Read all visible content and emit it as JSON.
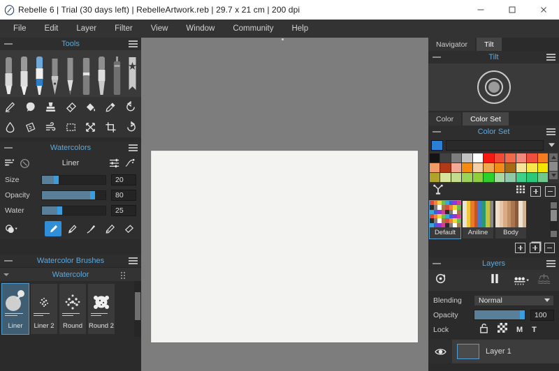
{
  "window": {
    "title": "Rebelle 6 | Trial (30 days left) | RebelleArtwork.reb | 29.7 x 21 cm | 200 dpi",
    "app_icon": "rebelle-logo-icon",
    "minimize_label": "–",
    "maximize_label": "□",
    "close_label": "✕"
  },
  "menubar": {
    "items": [
      {
        "label": "File"
      },
      {
        "label": "Edit"
      },
      {
        "label": "Layer"
      },
      {
        "label": "Filter"
      },
      {
        "label": "View"
      },
      {
        "label": "Window"
      },
      {
        "label": "Community"
      },
      {
        "label": "Help"
      }
    ]
  },
  "tools_panel": {
    "title": "Tools",
    "brushes": [
      {
        "name": "marker-tool",
        "selected": false
      },
      {
        "name": "ink-pen-tool",
        "selected": false
      },
      {
        "name": "watercolor-brush-tool",
        "selected": true
      },
      {
        "name": "nib-pen-tool",
        "selected": false
      },
      {
        "name": "pencil-tool",
        "selected": false
      },
      {
        "name": "pastel-tool",
        "selected": false
      },
      {
        "name": "oil-brush-tool",
        "selected": false
      },
      {
        "name": "airbrush-tool",
        "selected": false
      },
      {
        "name": "favorites-tool",
        "selected": false
      }
    ],
    "icons_row_1": [
      {
        "name": "blend-icon",
        "label": "Blend"
      },
      {
        "name": "smudge-icon",
        "label": "Smudge"
      },
      {
        "name": "stamp-icon",
        "label": "Stamp"
      },
      {
        "name": "eraser-icon",
        "label": "Eraser"
      },
      {
        "name": "fill-icon",
        "label": "Fill"
      },
      {
        "name": "eyedropper-icon",
        "label": "Pick Color"
      },
      {
        "name": "undo-icon",
        "label": "Undo"
      }
    ],
    "icons_row_2": [
      {
        "name": "water-drop-icon",
        "label": "Water"
      },
      {
        "name": "dry-icon",
        "label": "Dry"
      },
      {
        "name": "blow-icon",
        "label": "Blow"
      },
      {
        "name": "selection-icon",
        "label": "Select"
      },
      {
        "name": "transform-icon",
        "label": "Transform"
      },
      {
        "name": "crop-icon",
        "label": "Crop"
      },
      {
        "name": "rotate-icon",
        "label": "Rotate"
      }
    ]
  },
  "watercolors_panel": {
    "title": "Watercolors",
    "brush_name": "Liner",
    "left_icons": [
      {
        "name": "brush-presets-icon"
      },
      {
        "name": "reset-brush-icon"
      }
    ],
    "right_icons": [
      {
        "name": "brush-settings-icon"
      },
      {
        "name": "brush-dynamics-icon"
      }
    ],
    "sliders": [
      {
        "label": "Size",
        "value": "20",
        "percent": 22
      },
      {
        "label": "Opacity",
        "value": "80",
        "percent": 80
      },
      {
        "label": "Water",
        "value": "25",
        "percent": 28
      }
    ],
    "mode_menu_icon": "blend-mode-icon",
    "mode_buttons": [
      {
        "name": "paint-mode-button",
        "active": true
      },
      {
        "name": "wet-brush-mode-button",
        "active": false
      },
      {
        "name": "dry-brush-mode-button",
        "active": false
      },
      {
        "name": "pen-mode-button",
        "active": false
      },
      {
        "name": "eraser-mode-button",
        "active": false
      }
    ]
  },
  "brushes_panel": {
    "title": "Watercolor Brushes",
    "category": "Watercolor",
    "items": [
      {
        "label": "Liner",
        "selected": true
      },
      {
        "label": "Liner 2",
        "selected": false
      },
      {
        "label": "Round",
        "selected": false
      },
      {
        "label": "Round 2",
        "selected": false
      }
    ]
  },
  "navigator_panel": {
    "tabs": [
      {
        "label": "Navigator",
        "active": false
      },
      {
        "label": "Tilt",
        "active": true
      }
    ],
    "tilt_title": "Tilt",
    "tilt_control_icon": "tilt-joystick-icon"
  },
  "color_panel": {
    "tabs": [
      {
        "label": "Color",
        "active": false
      },
      {
        "label": "Color Set",
        "active": true
      }
    ],
    "title": "Color Set",
    "current_color": "#2b7fd4",
    "search_placeholder": "",
    "swatches": [
      "#141414",
      "#414141",
      "#7d7d7d",
      "#c2c2c2",
      "#ffffff",
      "#f51b12",
      "#f04b34",
      "#f06a4a",
      "#f0887c",
      "#ef4f3e",
      "#f57c20",
      "#f09a68",
      "#b03a18",
      "#f3a993",
      "#f58b10",
      "#f6cfa4",
      "#f0a84e",
      "#f08c18",
      "#a96a14",
      "#f5e49a",
      "#f5e64a",
      "#f5e400",
      "#b0a22a",
      "#d8e29a",
      "#c3dd8e",
      "#9cd45a",
      "#8fcf3c",
      "#2fd02c",
      "#a8d8a2",
      "#8fc9a8",
      "#3fd08a",
      "#2bc97a",
      "#6fc98a"
    ],
    "tools": [
      {
        "name": "color-mixer-icon"
      },
      {
        "name": "grid-view-icon"
      },
      {
        "name": "add-color-button"
      },
      {
        "name": "remove-color-button"
      }
    ],
    "presets": [
      {
        "label": "Default",
        "selected": true
      },
      {
        "label": "Aniline",
        "selected": false
      },
      {
        "label": "Body",
        "selected": false
      }
    ],
    "preset_actions": [
      {
        "name": "add-color-set-button"
      },
      {
        "name": "duplicate-color-set-button"
      },
      {
        "name": "remove-color-set-button"
      }
    ]
  },
  "layers_panel": {
    "title": "Layers",
    "toolbar": [
      {
        "name": "dry-layer-icon"
      },
      {
        "name": "pause-diffusion-icon"
      },
      {
        "name": "canvas-texture-icon"
      },
      {
        "name": "tilt-canvas-icon"
      }
    ],
    "blending_label": "Blending",
    "blending_value": "Normal",
    "opacity_label": "Opacity",
    "opacity_value": "100",
    "opacity_percent": 96,
    "lock_label": "Lock",
    "lock_buttons": [
      {
        "name": "lock-transparency-icon",
        "label": ""
      },
      {
        "name": "lock-alpha-icon",
        "label": ""
      },
      {
        "name": "lock-mask-button",
        "label": "M"
      },
      {
        "name": "lock-transform-button",
        "label": "T"
      }
    ],
    "layers": [
      {
        "name": "Layer 1",
        "visible": true,
        "selected": true
      }
    ]
  },
  "theme": {
    "accent": "#5ea9dd",
    "accent_button": "#2f8fd8",
    "panel_bg": "#2e2e2e",
    "canvas_bg": "#7d7d7d",
    "paper": "#f3f3f1"
  }
}
